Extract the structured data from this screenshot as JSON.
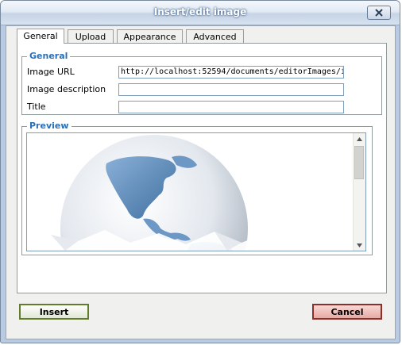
{
  "window": {
    "title": "Insert/edit image"
  },
  "tabs": [
    {
      "label": "General",
      "active": true
    },
    {
      "label": "Upload",
      "active": false
    },
    {
      "label": "Appearance",
      "active": false
    },
    {
      "label": "Advanced",
      "active": false
    }
  ],
  "general": {
    "legend": "General",
    "image_url": {
      "label": "Image URL",
      "value": "http://localhost:52594/documents/editorImages/i"
    },
    "image_description": {
      "label": "Image description",
      "value": ""
    },
    "title": {
      "label": "Title",
      "value": ""
    }
  },
  "preview": {
    "legend": "Preview",
    "image": "globe-image"
  },
  "buttons": {
    "insert": "Insert",
    "cancel": "Cancel"
  },
  "colors": {
    "legend": "#2b6fb6",
    "insert_border": "#5f7d2c",
    "cancel_border": "#8c2f2a"
  }
}
